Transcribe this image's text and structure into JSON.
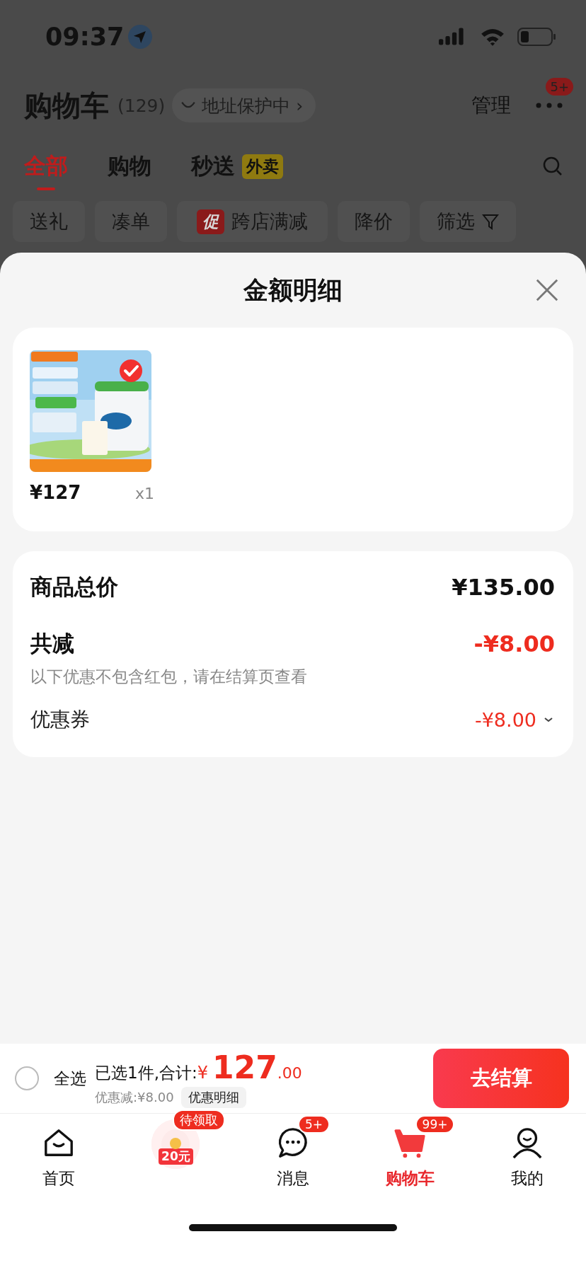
{
  "status_bar": {
    "time": "09:37"
  },
  "header": {
    "title": "购物车",
    "count": "(129)",
    "address_badge": "地址保护中",
    "address_arrow": "›",
    "manage": "管理",
    "more_badge": "5+"
  },
  "tabs": [
    {
      "label": "全部",
      "selected": true
    },
    {
      "label": "购物",
      "selected": false
    },
    {
      "label": "秒送",
      "tag": "外卖",
      "selected": false
    }
  ],
  "filters": [
    {
      "label": "送礼",
      "kind": "plain"
    },
    {
      "label": "凑单",
      "kind": "plain"
    },
    {
      "label": "跨店满减",
      "kind": "promo",
      "tag": "促"
    },
    {
      "label": "降价",
      "kind": "plain"
    },
    {
      "label": "筛选",
      "kind": "filter"
    }
  ],
  "sheet": {
    "title": "金额明细",
    "items": [
      {
        "kind": "picture",
        "price": "¥127",
        "qty": "x1",
        "checked": true
      }
    ],
    "summary": {
      "total_label": "商品总价",
      "total": "¥135.00",
      "reduce_label": "共减",
      "reduce": "-¥8.00",
      "note": "以下优惠不包含红包，请在结算页查看",
      "coupon_label": "优惠券",
      "coupon": "-¥8.00"
    }
  },
  "bottom_bar": {
    "select_all": {
      "label": "全选",
      "checked": false
    },
    "selected_text": "已选1件,合计:",
    "currency": "¥",
    "amount": "127",
    "decimals": ".00",
    "discount": "优惠减:¥8.00",
    "detail_button": "优惠明细",
    "checkout": "去结算"
  },
  "nav": [
    {
      "kind": "home",
      "label": "首页",
      "selected": false
    },
    {
      "kind": "redpacket",
      "badge": "待领取",
      "amount": "20元"
    },
    {
      "kind": "message",
      "label": "消息",
      "badge": "5+",
      "selected": false
    },
    {
      "kind": "cart",
      "label": "购物车",
      "badge": "99+",
      "selected": true
    },
    {
      "kind": "profile",
      "label": "我的",
      "selected": false
    }
  ]
}
